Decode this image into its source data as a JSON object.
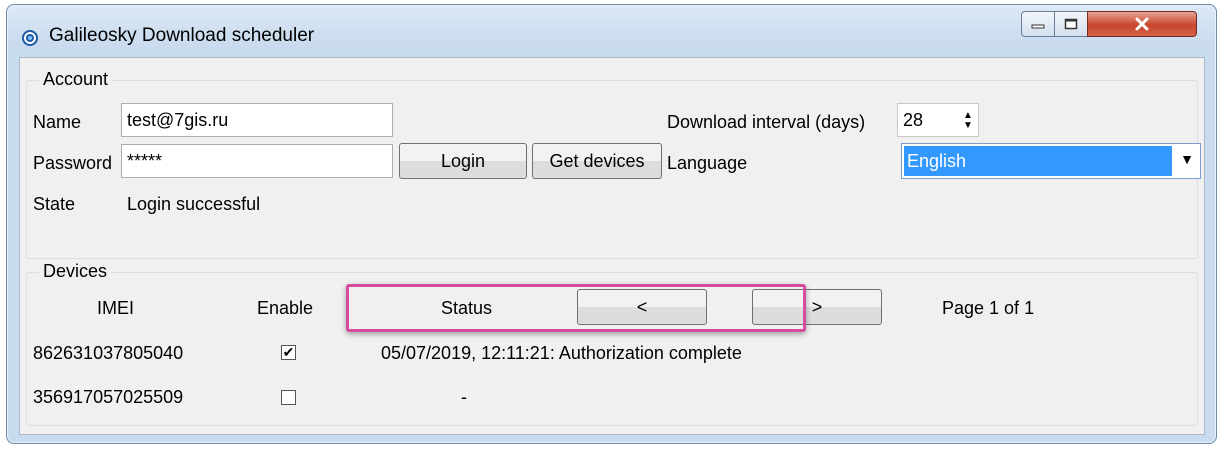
{
  "window": {
    "title": "Galileosky Download scheduler",
    "icons": {
      "app": "galileosky-app-icon",
      "minimize": "minimize-icon",
      "maximize": "maximize-icon",
      "close": "close-icon"
    }
  },
  "account": {
    "group_title": "Account",
    "name_label": "Name",
    "name_value": "test@7gis.ru",
    "password_label": "Password",
    "password_value": "*****",
    "login_button": "Login",
    "get_devices_button": "Get devices",
    "interval_label": "Download interval (days)",
    "interval_value": "28",
    "language_label": "Language",
    "language_value": "English",
    "state_label": "State",
    "state_value": "Login successful"
  },
  "devices": {
    "group_title": "Devices",
    "headers": {
      "imei": "IMEI",
      "enable": "Enable",
      "status": "Status"
    },
    "prev_button": "<",
    "next_button": ">",
    "page_text": "Page 1 of 1",
    "rows": [
      {
        "imei": "862631037805040",
        "enabled": true,
        "status": "05/07/2019, 12:11:21: Authorization complete"
      },
      {
        "imei": "356917057025509",
        "enabled": false,
        "status": "-"
      }
    ]
  },
  "colors": {
    "highlight": "#d64b9a",
    "selection": "#3399ff",
    "close_button": "#c8452c"
  }
}
